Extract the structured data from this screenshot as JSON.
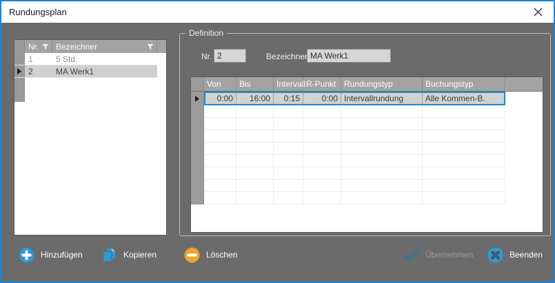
{
  "window": {
    "title": "Rundungsplan"
  },
  "colors": {
    "window_border_blue": "#1a84d8",
    "accent_blue": "#2b9ad6",
    "selection_border_blue": "#1d8ad3",
    "warning_orange": "#eea32a",
    "disabled_check_blue": "#43718c",
    "disabled_text_gray": "#9b9b9b",
    "client_background": "#6b6b6b"
  },
  "plan_list": {
    "headers": {
      "nr": "Nr.",
      "bezeichner": "Bezeichner"
    },
    "rows": [
      {
        "nr": "1",
        "bezeichner": "5 Std."
      },
      {
        "nr": "2",
        "bezeichner": "MA Werk1"
      }
    ],
    "selected_row_index": 1
  },
  "definition": {
    "group_label": "Definition",
    "fields": {
      "nr_label": "Nr.",
      "nr_value": "2",
      "bezeichner_label": "Bezeichner",
      "bezeichner_value": "MA Werk1"
    },
    "grid": {
      "columns": [
        "Von",
        "Bis",
        "Intervall",
        "R-Punkt",
        "Rundungstyp",
        "Buchungstyp"
      ],
      "rows": [
        {
          "von": "0:00",
          "bis": "16:00",
          "intervall": "0:15",
          "r_punkt": "0:00",
          "rundungstyp": "Intervallrundung",
          "buchungstyp": "Alle Kommen-B."
        }
      ],
      "selected_row_index": 0,
      "empty_row_count": 8
    }
  },
  "toolbar": {
    "buttons": [
      {
        "id": "add",
        "label": "Hinzufügen",
        "icon": "plus-circle-icon",
        "enabled": true
      },
      {
        "id": "copy",
        "label": "Kopieren",
        "icon": "copy-icon",
        "enabled": true
      },
      {
        "id": "delete",
        "label": "Löschen",
        "icon": "minus-circle-icon",
        "enabled": true
      },
      {
        "id": "apply",
        "label": "Übernehmen",
        "icon": "check-icon",
        "enabled": false
      },
      {
        "id": "close",
        "label": "Beenden",
        "icon": "close-circle-icon",
        "enabled": true
      }
    ]
  }
}
